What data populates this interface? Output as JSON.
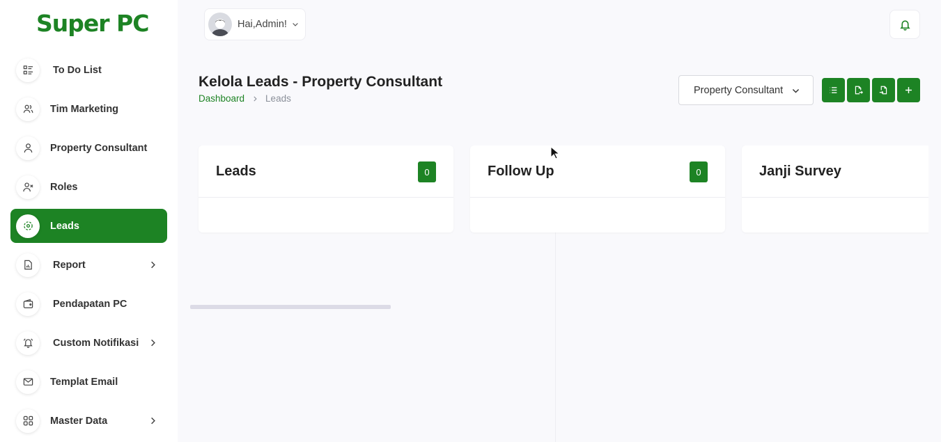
{
  "app": {
    "logo": "Super PC"
  },
  "sidebar": {
    "items": [
      {
        "label": "To Do List",
        "icon": "list-icon"
      },
      {
        "label": "Tim Marketing",
        "icon": "users-icon"
      },
      {
        "label": "Property Consultant",
        "icon": "user-icon"
      },
      {
        "label": "Roles",
        "icon": "user-x-icon"
      },
      {
        "label": "Leads",
        "icon": "target-icon",
        "active": true
      },
      {
        "label": "Report",
        "icon": "file-chart-icon",
        "has_submenu": true
      },
      {
        "label": "Pendapatan PC",
        "icon": "wallet-icon"
      },
      {
        "label": "Custom Notifikasi",
        "icon": "bell-ring-icon",
        "has_submenu": true
      },
      {
        "label": "Templat Email",
        "icon": "mail-icon"
      },
      {
        "label": "Master Data",
        "icon": "grid-icon",
        "has_submenu": true
      }
    ]
  },
  "header": {
    "greeting": "Hai,Admin!"
  },
  "page": {
    "title": "Kelola Leads - Property Consultant",
    "breadcrumb": [
      "Dashboard",
      "Leads"
    ],
    "filter_selected": "Property Consultant"
  },
  "board": {
    "columns": [
      {
        "title": "Leads",
        "count": "0"
      },
      {
        "title": "Follow Up",
        "count": "0"
      },
      {
        "title": "Janji Survey",
        "count": ""
      }
    ]
  },
  "colors": {
    "accent": "#1d8324"
  }
}
